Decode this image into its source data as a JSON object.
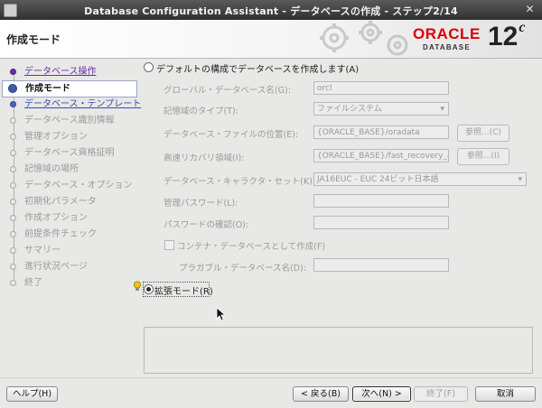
{
  "window": {
    "title": "Database Configuration Assistant - データベースの作成 - ステップ2/14",
    "close_glyph": "✕"
  },
  "header": {
    "step_title": "作成モード",
    "brand": "ORACLE",
    "brand_sub": "DATABASE",
    "version_number": "12",
    "version_suffix": "c"
  },
  "sidebar": {
    "items": [
      {
        "label": "データベース操作",
        "state": "done"
      },
      {
        "label": "作成モード",
        "state": "current"
      },
      {
        "label": "データベース・テンプレート",
        "state": "link"
      },
      {
        "label": "データベース識別情報",
        "state": "disabled"
      },
      {
        "label": "管理オプション",
        "state": "disabled"
      },
      {
        "label": "データベース資格証明",
        "state": "disabled"
      },
      {
        "label": "記憶域の場所",
        "state": "disabled"
      },
      {
        "label": "データベース・オプション",
        "state": "disabled"
      },
      {
        "label": "初期化パラメータ",
        "state": "disabled"
      },
      {
        "label": "作成オプション",
        "state": "disabled"
      },
      {
        "label": "前提条件チェック",
        "state": "disabled"
      },
      {
        "label": "サマリー",
        "state": "disabled"
      },
      {
        "label": "進行状況ページ",
        "state": "disabled"
      },
      {
        "label": "終了",
        "state": "disabled"
      }
    ]
  },
  "main": {
    "default_option": "デフォルトの構成でデータベースを作成します(A)",
    "advanced_option": "拡張モード(R)",
    "fields": {
      "global_name": {
        "label": "グローバル・データベース名(G):",
        "value": "orcl"
      },
      "storage_type": {
        "label": "記憶域のタイプ(T):",
        "value": "ファイルシステム"
      },
      "file_location": {
        "label": "データベース・ファイルの位置(E):",
        "value": "{ORACLE_BASE}/oradata",
        "button": "参照...(C)"
      },
      "recovery_area": {
        "label": "高速リカバリ領域(I):",
        "value": "{ORACLE_BASE}/fast_recovery_are",
        "button": "参照...(I)"
      },
      "charset": {
        "label": "データベース・キャラクタ・セット(K):",
        "value": "JA16EUC - EUC 24ビット日本語"
      },
      "admin_password": {
        "label": "管理パスワード(L):",
        "value": ""
      },
      "confirm_password": {
        "label": "パスワードの確認(O):",
        "value": ""
      },
      "container": {
        "label": "コンテナ・データベースとして作成(F)"
      },
      "pluggable_name": {
        "label": "プラガブル・データベース名(D):",
        "value": ""
      }
    }
  },
  "footer": {
    "help": "ヘルプ(H)",
    "back": "< 戻る(B)",
    "next": "次へ(N) >",
    "finish": "終了(F)",
    "cancel": "取消"
  },
  "colors": {
    "done_link": "#6a2fa8",
    "active_link": "#3050b0",
    "brand_red": "#dd0000"
  }
}
